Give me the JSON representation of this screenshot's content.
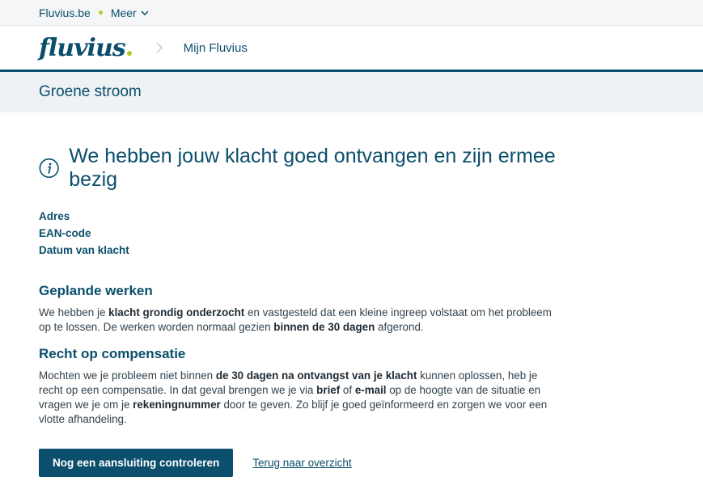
{
  "topbar": {
    "site": "Fluvius.be",
    "more": "Meer"
  },
  "header": {
    "logo": "fluvius",
    "breadcrumb": "Mijn Fluvius"
  },
  "subheader": {
    "title": "Groene stroom"
  },
  "main": {
    "title": "We hebben jouw klacht goed ontvangen en zijn ermee bezig",
    "meta": [
      "Adres",
      "EAN-code",
      "Datum van klacht"
    ],
    "sections": [
      {
        "heading": "Geplande werken",
        "text": [
          {
            "t": "We hebben je "
          },
          {
            "b": "klacht grondig onderzocht"
          },
          {
            "t": " en vastgesteld dat een kleine ingreep volstaat om het probleem op te lossen. De werken worden normaal gezien "
          },
          {
            "b": "binnen de 30 dagen"
          },
          {
            "t": " afgerond."
          }
        ]
      },
      {
        "heading": "Recht op compensatie",
        "text": [
          {
            "t": "Mochten we je probleem niet binnen "
          },
          {
            "b": "de 30 dagen na ontvangst van je klacht"
          },
          {
            "t": " kunnen oplossen, heb je recht op een compensatie. In dat geval brengen we je via "
          },
          {
            "b": "brief"
          },
          {
            "t": " of "
          },
          {
            "b": "e-mail"
          },
          {
            "t": " op de hoogte van de situatie en vragen we je om je "
          },
          {
            "b": "rekeningnummer"
          },
          {
            "t": " door te geven. Zo blijf je goed geïnformeerd en zorgen we voor een vlotte afhandeling."
          }
        ]
      }
    ],
    "primary_button": "Nog een aansluiting controleren",
    "back_link": "Terug naar overzicht"
  },
  "colors": {
    "brand": "#0b4f6c",
    "accent": "#b5c929"
  }
}
